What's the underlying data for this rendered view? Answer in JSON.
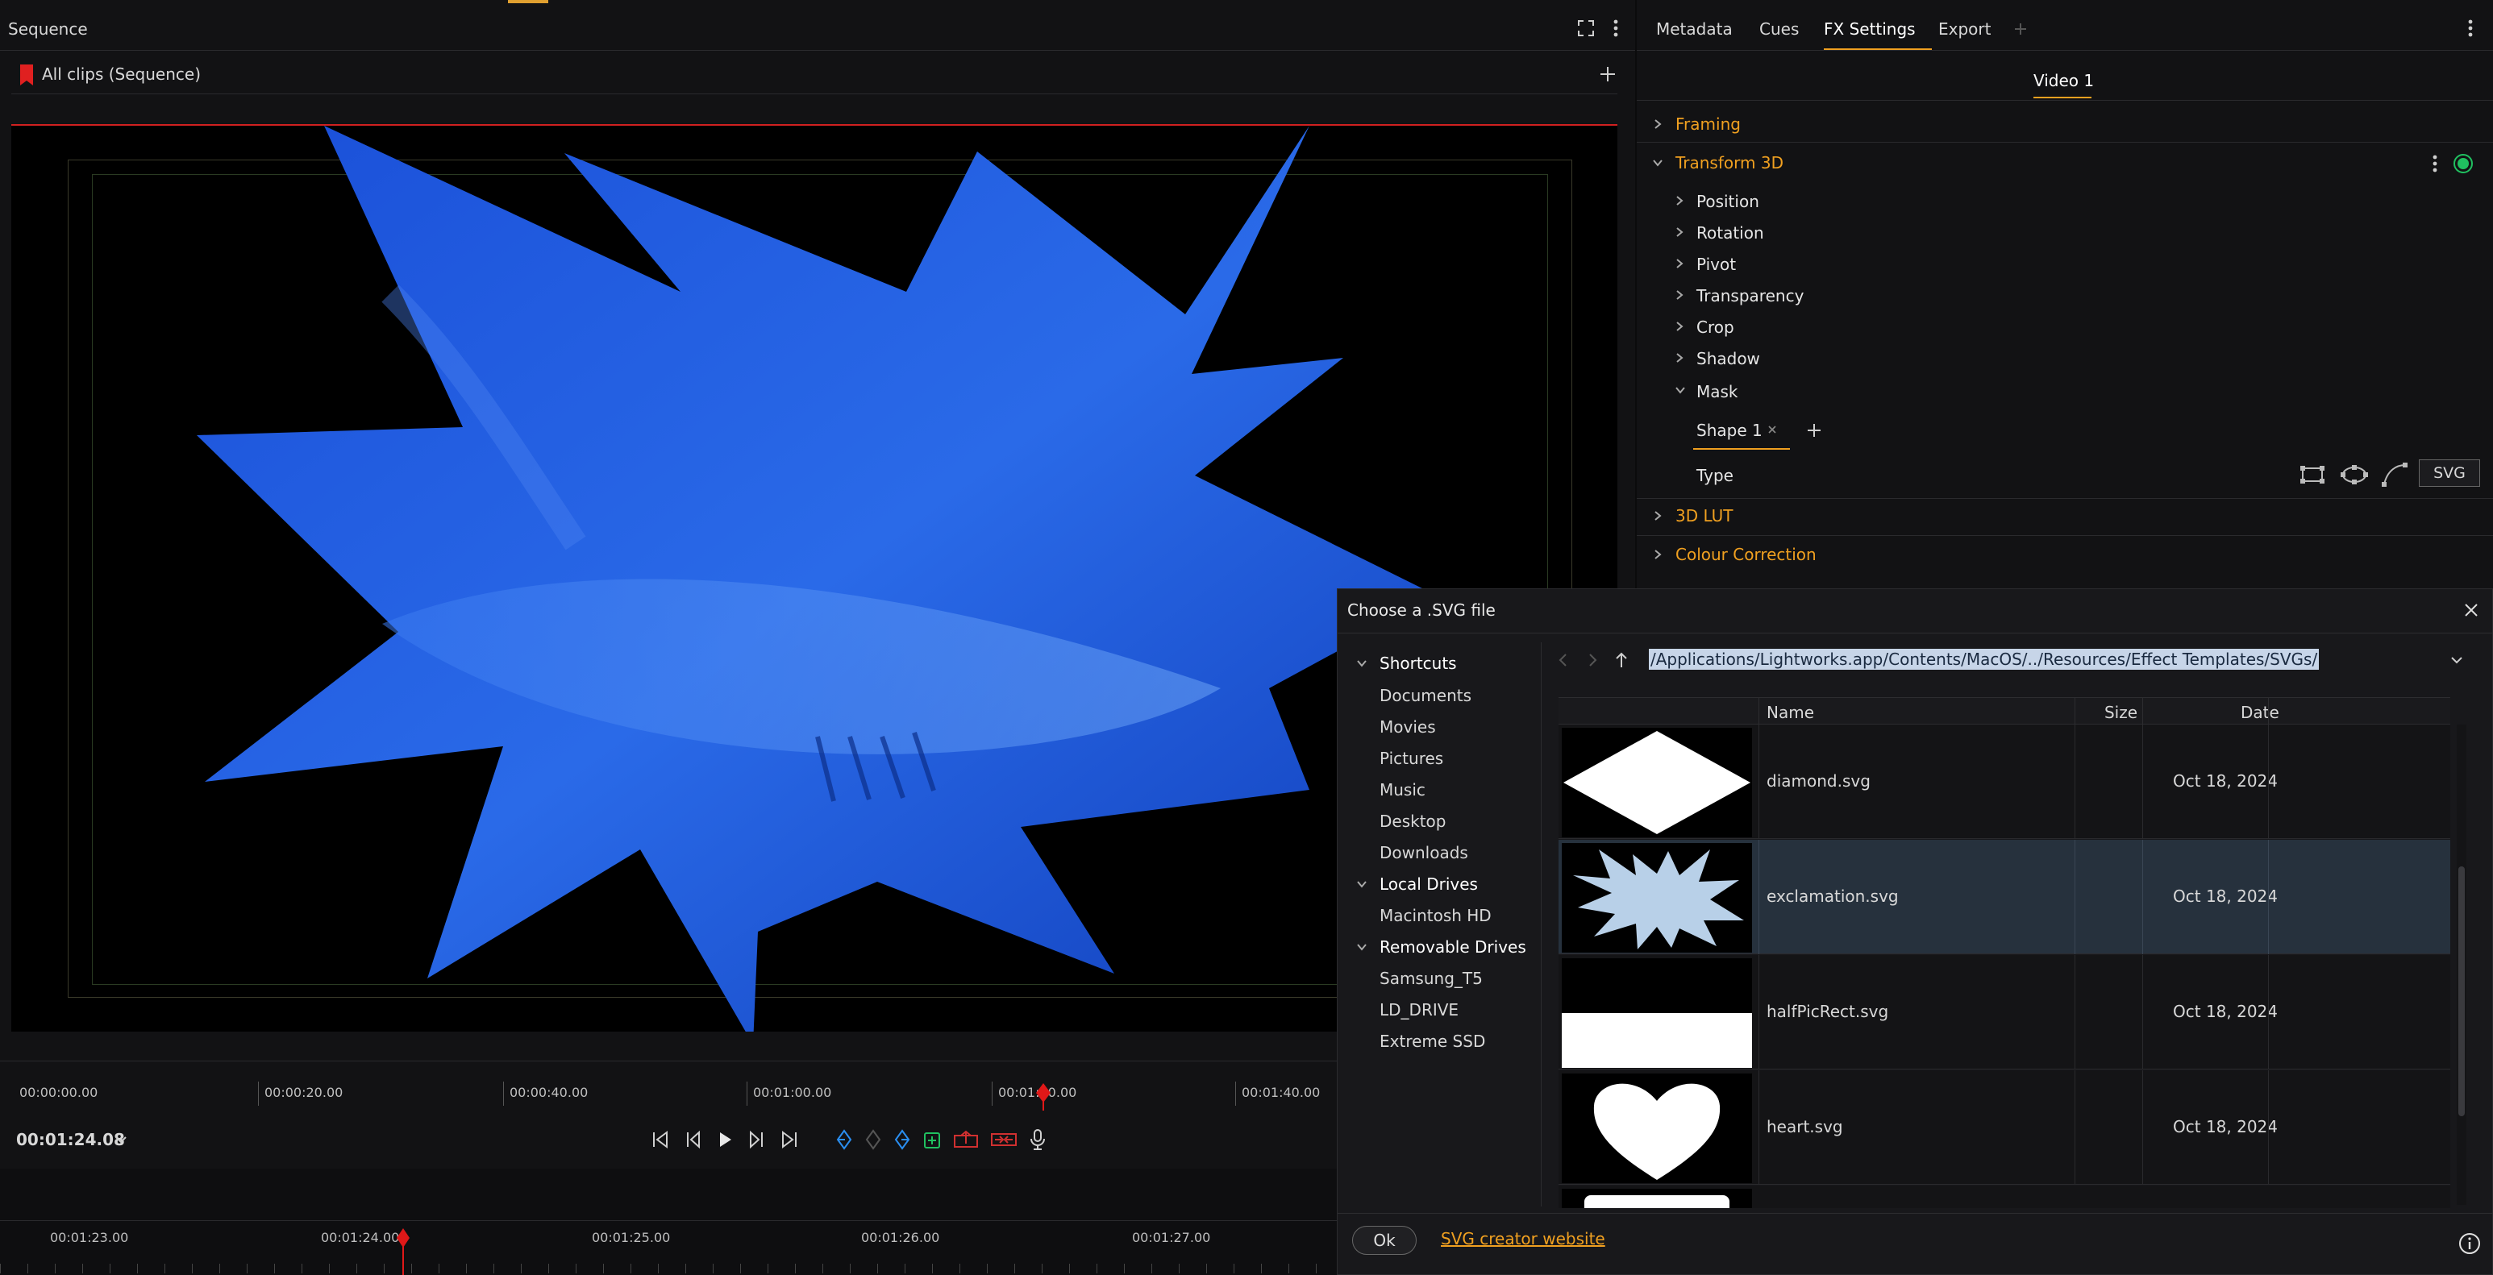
{
  "sequence": {
    "title": "Sequence",
    "bin_label": "All clips (Sequence)",
    "ruler": [
      "00:00:00.00",
      "00:00:20.00",
      "00:00:40.00",
      "00:01:00.00",
      "00:01:20.00",
      "00:01:40.00"
    ],
    "timecode": "00:01:24.08"
  },
  "timeline": {
    "ruler": [
      "00:01:23.00",
      "00:01:24.00",
      "00:01:25.00",
      "00:01:26.00",
      "00:01:27.00"
    ]
  },
  "fx": {
    "tabs": [
      "Metadata",
      "Cues",
      "FX Settings",
      "Export"
    ],
    "active_tab": "FX Settings",
    "subtab": "Video 1",
    "sections": {
      "framing": "Framing",
      "transform": "Transform 3D",
      "lut": "3D LUT",
      "colour": "Colour Correction"
    },
    "transform_items": [
      "Position",
      "Rotation",
      "Pivot",
      "Transparency",
      "Crop",
      "Shadow",
      "Mask"
    ],
    "shape_tab": "Shape 1",
    "type_label": "Type",
    "svg_button": "SVG",
    "accent": "#f0a020"
  },
  "dialog": {
    "title": "Choose a .SVG file",
    "path": "/Applications/Lightworks.app/Contents/MacOS/../Resources/Effect Templates/SVGs/",
    "shortcuts_label": "Shortcuts",
    "shortcuts": [
      "Documents",
      "Movies",
      "Pictures",
      "Music",
      "Desktop",
      "Downloads"
    ],
    "local_label": "Local Drives",
    "local": [
      "Macintosh HD"
    ],
    "removable_label": "Removable Drives",
    "removable": [
      "Samsung_T5",
      "LD_DRIVE",
      "Extreme SSD"
    ],
    "columns": {
      "name": "Name",
      "size": "Size",
      "date": "Date"
    },
    "files": [
      {
        "name": "diamond.svg",
        "size": "",
        "date": "Oct 18, 2024"
      },
      {
        "name": "exclamation.svg",
        "size": "",
        "date": "Oct 18, 2024"
      },
      {
        "name": "halfPicRect.svg",
        "size": "",
        "date": "Oct 18, 2024"
      },
      {
        "name": "heart.svg",
        "size": "",
        "date": "Oct 18, 2024"
      }
    ],
    "selected": "exclamation.svg",
    "ok_label": "Ok",
    "website_label": "SVG creator website"
  }
}
